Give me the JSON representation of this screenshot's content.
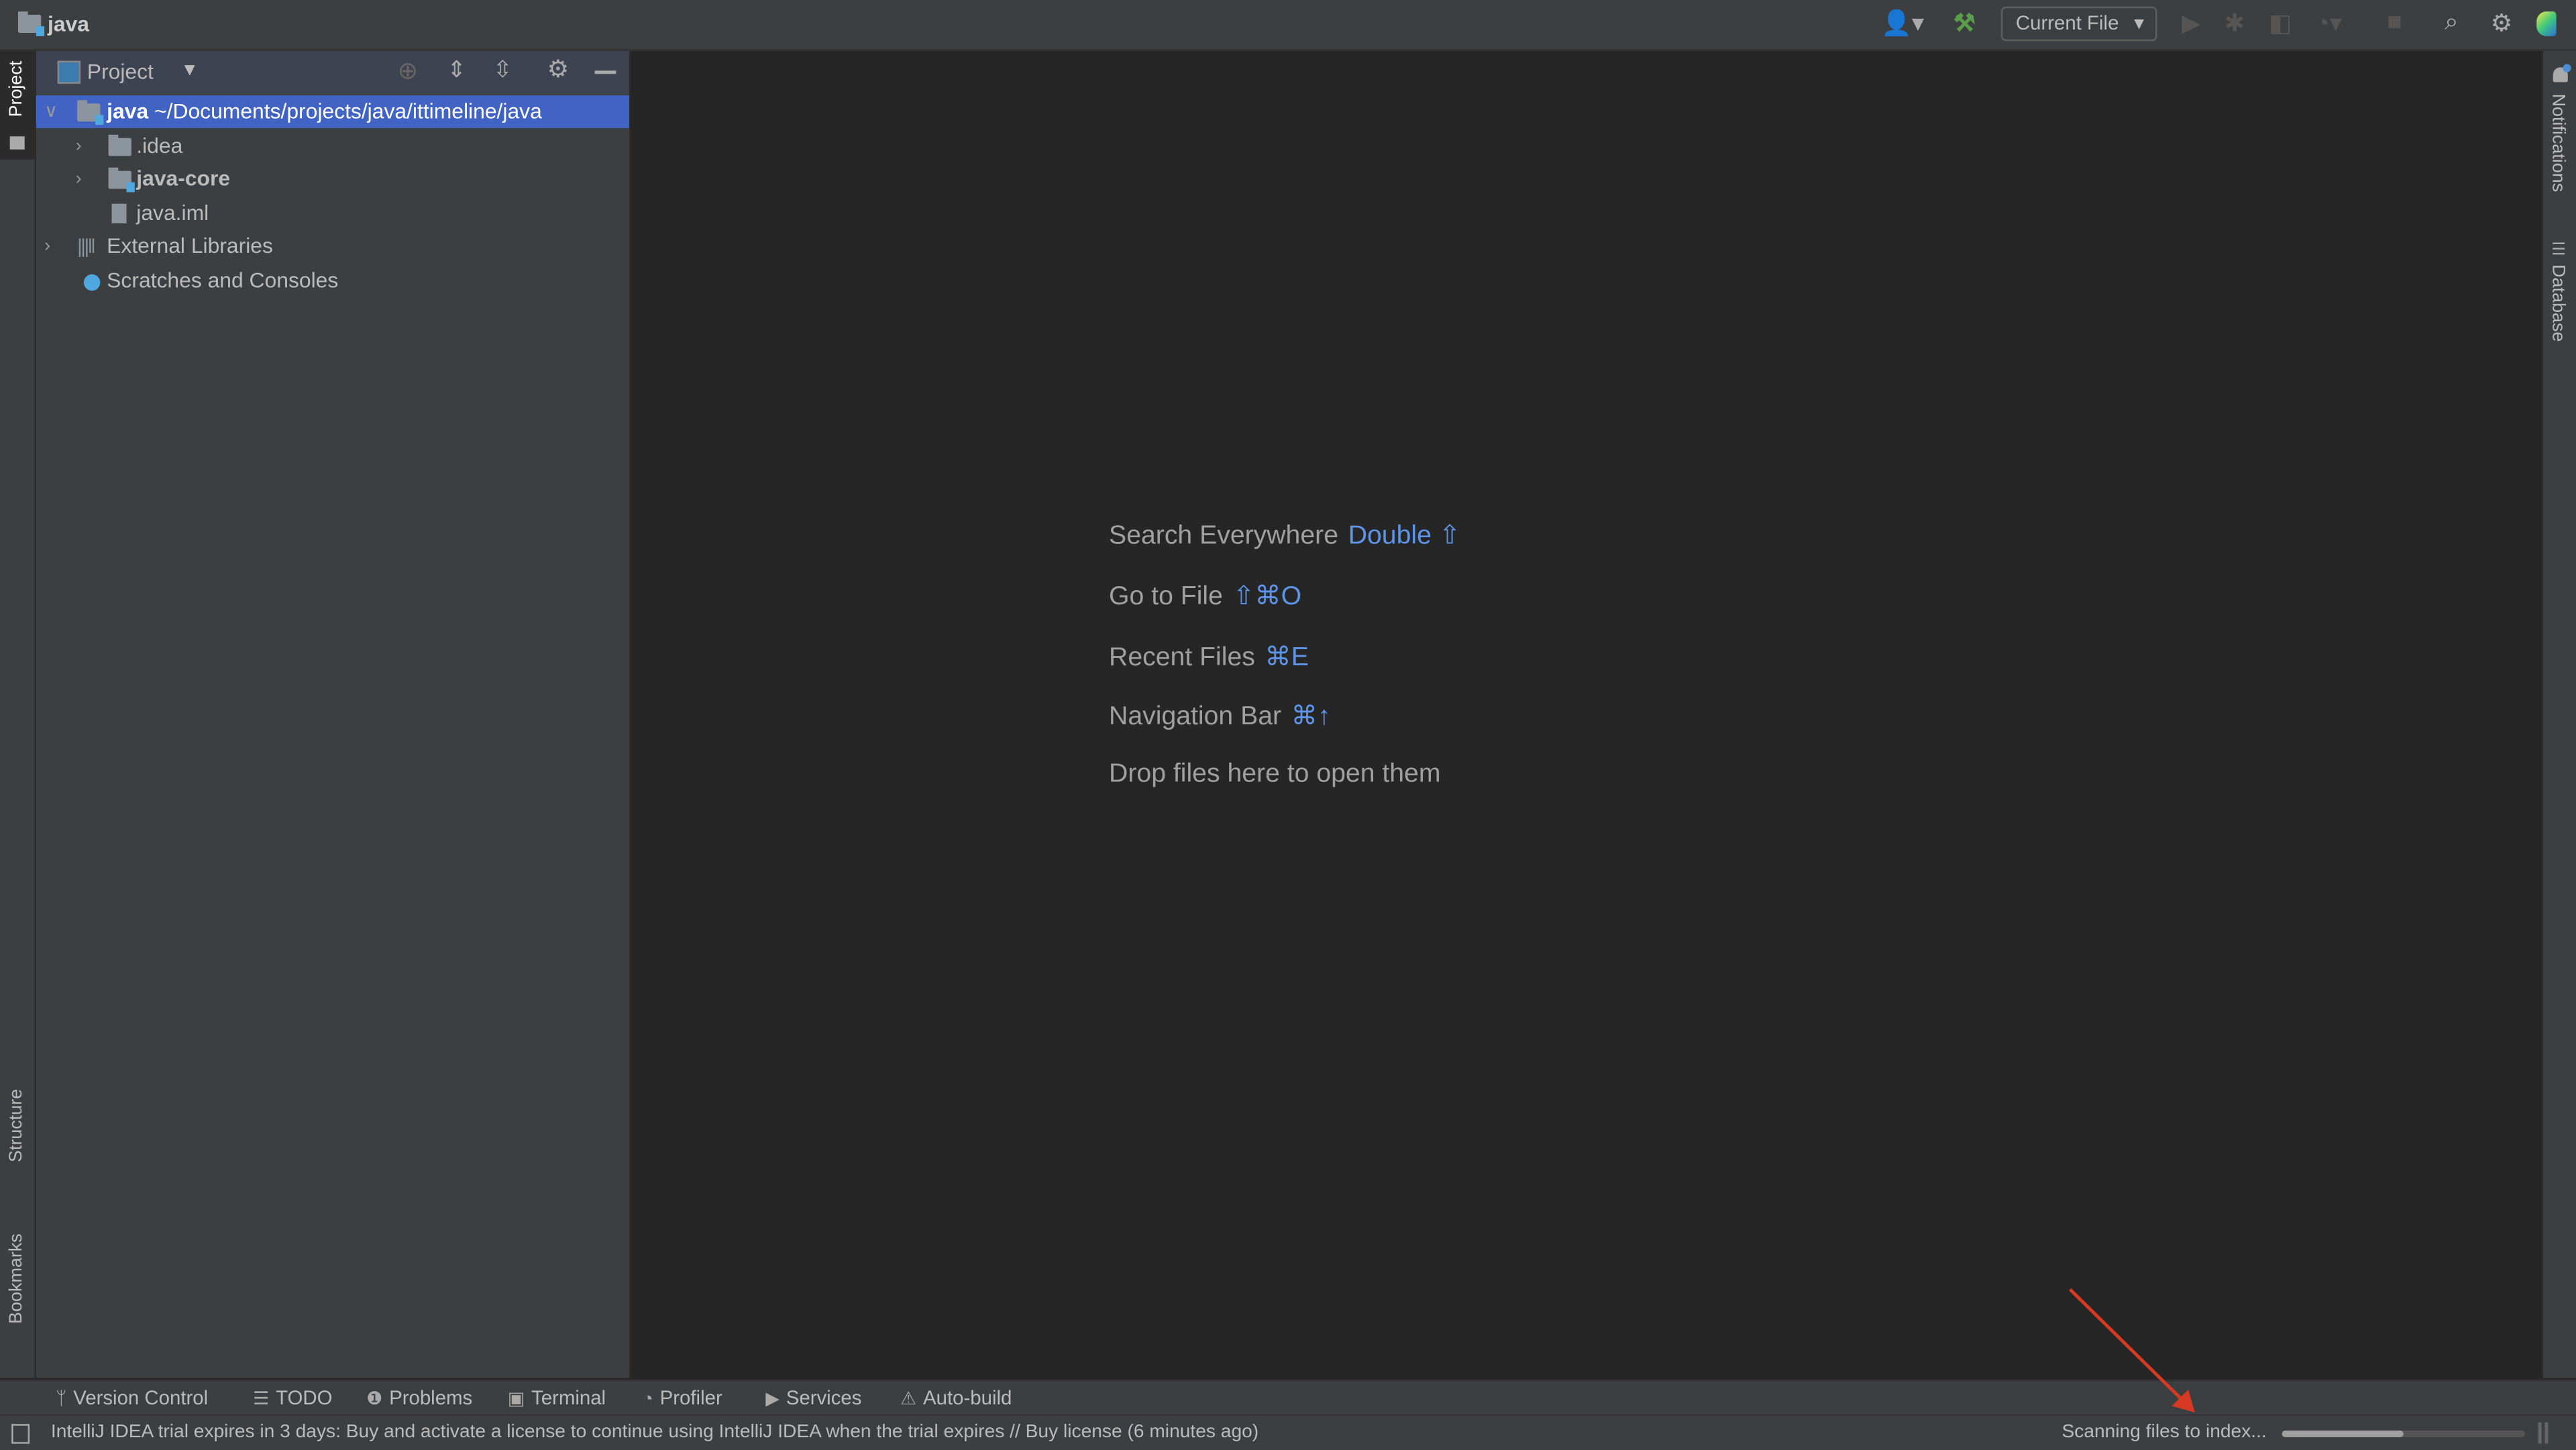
{
  "titlebar": {
    "project_name": "java",
    "run_config": "Current File"
  },
  "left_strip": {
    "project_tab": "Project",
    "structure_tab": "Structure",
    "bookmarks_tab": "Bookmarks"
  },
  "right_strip": {
    "notifications_tab": "Notifications",
    "database_tab": "Database"
  },
  "project_panel": {
    "title": "Project",
    "tree": [
      {
        "name": "java",
        "path": "~/Documents/projects/java/ittimeline/java",
        "selected": true,
        "expanded": true
      },
      {
        "name": ".idea"
      },
      {
        "name": "java-core"
      },
      {
        "name": "java.iml"
      },
      {
        "name": "External Libraries"
      },
      {
        "name": "Scratches and Consoles"
      }
    ]
  },
  "editor_hints": [
    {
      "label": "Search Everywhere",
      "shortcut": "Double ⇧"
    },
    {
      "label": "Go to File",
      "shortcut": "⇧⌘O"
    },
    {
      "label": "Recent Files",
      "shortcut": "⌘E"
    },
    {
      "label": "Navigation Bar",
      "shortcut": "⌘↑"
    },
    {
      "label": "Drop files here to open them",
      "shortcut": ""
    }
  ],
  "tool_windows": [
    "Version Control",
    "TODO",
    "Problems",
    "Terminal",
    "Profiler",
    "Services",
    "Auto-build"
  ],
  "status_bar": {
    "message": "IntelliJ IDEA trial expires in 3 days: Buy and activate a license to continue using IntelliJ IDEA when the trial expires // Buy license (6 minutes ago)",
    "progress_label": "Scanning files to index...",
    "progress_percent": 50
  },
  "colors": {
    "selection": "#4063c4",
    "shortcut": "#5e94e8",
    "annotation_arrow": "#d63a22"
  }
}
